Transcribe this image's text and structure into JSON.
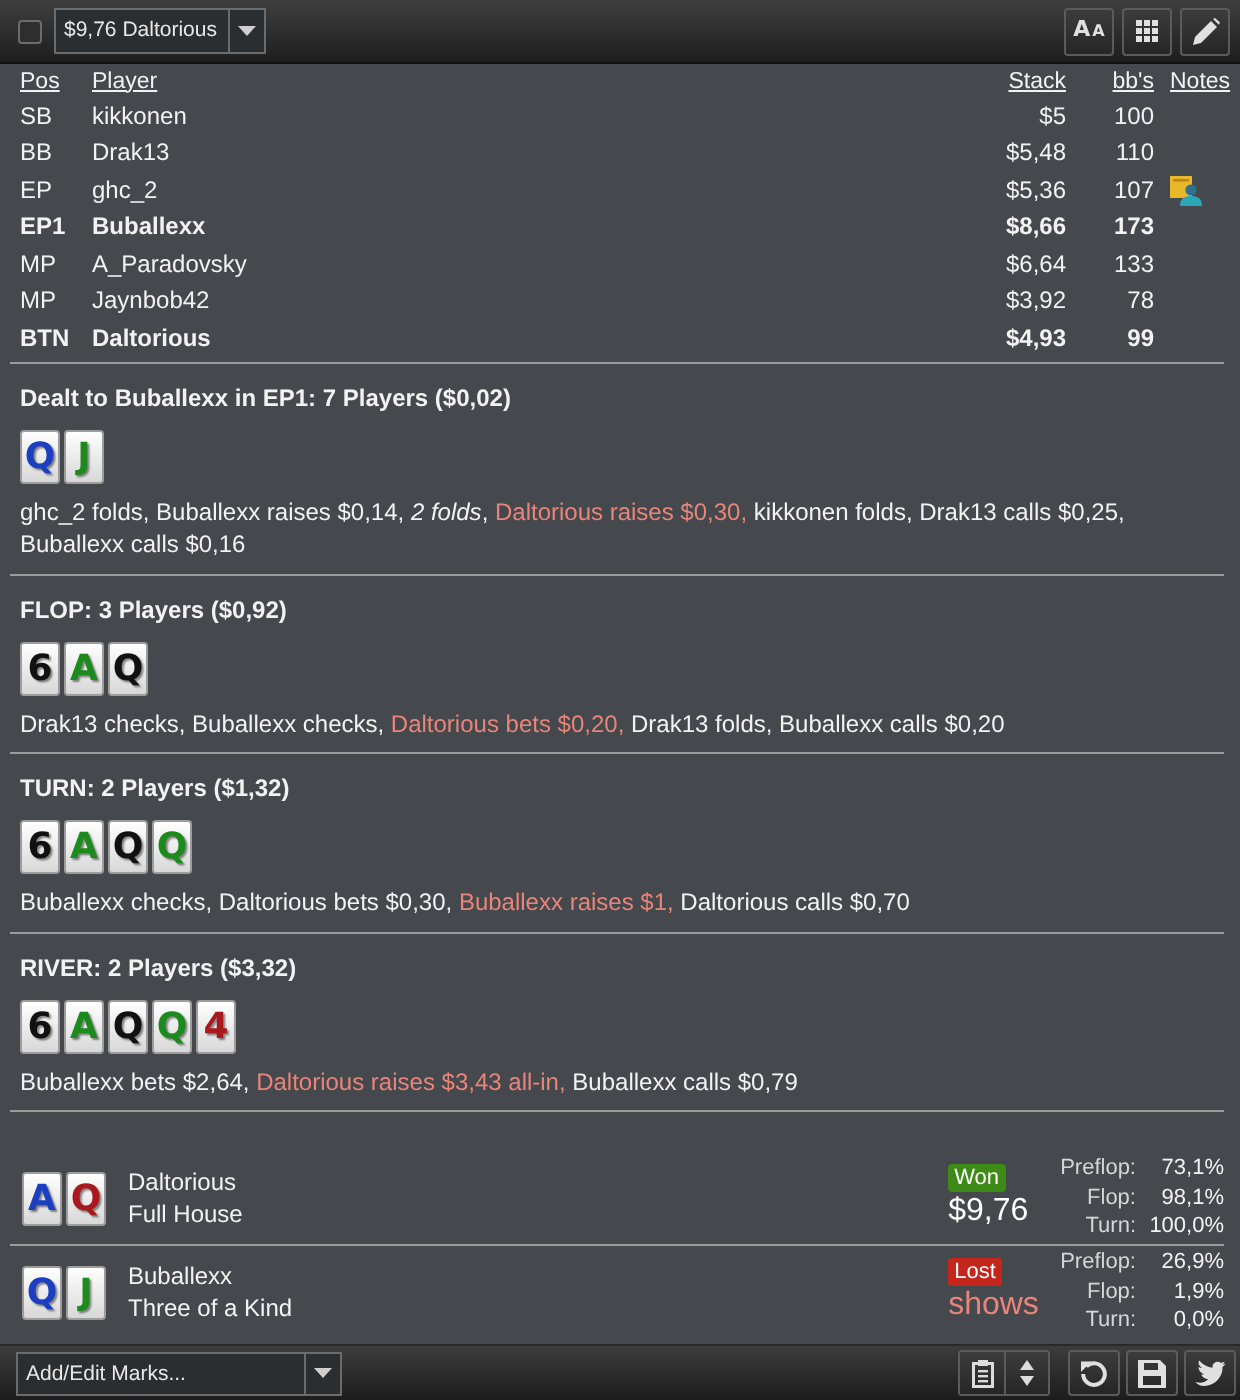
{
  "toolbar": {
    "checkbox": {
      "checked": false
    },
    "hand_dropdown": {
      "value": "$9,76 Daltorious"
    },
    "font_button": {
      "glyphs": [
        "A",
        "A"
      ]
    }
  },
  "players_table": {
    "columns": [
      "Pos",
      "Player",
      "Stack",
      "bb's",
      "Notes"
    ],
    "rows": [
      {
        "pos": "SB",
        "player": "kikkonen",
        "stack": "$5",
        "bbs": "100",
        "bold": false,
        "has_note": false
      },
      {
        "pos": "BB",
        "player": "Drak13",
        "stack": "$5,48",
        "bbs": "110",
        "bold": false,
        "has_note": false
      },
      {
        "pos": "EP",
        "player": "ghc_2",
        "stack": "$5,36",
        "bbs": "107",
        "bold": false,
        "has_note": true
      },
      {
        "pos": "EP1",
        "player": "Buballexx",
        "stack": "$8,66",
        "bbs": "173",
        "bold": true,
        "has_note": false
      },
      {
        "pos": "MP",
        "player": "A_Paradovsky",
        "stack": "$6,64",
        "bbs": "133",
        "bold": false,
        "has_note": false
      },
      {
        "pos": "MP",
        "player": "Jaynbob42",
        "stack": "$3,92",
        "bbs": "78",
        "bold": false,
        "has_note": false
      },
      {
        "pos": "BTN",
        "player": "Daltorious",
        "stack": "$4,93",
        "bbs": "99",
        "bold": true,
        "has_note": false
      }
    ]
  },
  "streets": [
    {
      "title": "Dealt to Buballexx in EP1: 7 Players ($0,02)",
      "cards": [
        {
          "rank": "Q",
          "color": "#1b3fc0"
        },
        {
          "rank": "J",
          "color": "#1d8a1d"
        }
      ],
      "actions": [
        {
          "text": "ghc_2 folds, Buballexx raises $0,14, ",
          "kind": "plain"
        },
        {
          "text": "2 folds",
          "kind": "italic"
        },
        {
          "text": ", ",
          "kind": "plain"
        },
        {
          "text": "Daltorious raises $0,30,",
          "kind": "raise"
        },
        {
          "text": " kikkonen folds, Drak13 calls $0,25, Buballexx calls $0,16",
          "kind": "plain"
        }
      ]
    },
    {
      "title": "FLOP: 3 Players ($0,92)",
      "cards": [
        {
          "rank": "6",
          "color": "#111111"
        },
        {
          "rank": "A",
          "color": "#1d8a1d"
        },
        {
          "rank": "Q",
          "color": "#111111"
        }
      ],
      "actions": [
        {
          "text": "Drak13 checks, Buballexx checks, ",
          "kind": "plain"
        },
        {
          "text": "Daltorious bets $0,20,",
          "kind": "raise"
        },
        {
          "text": " Drak13 folds, Buballexx calls $0,20",
          "kind": "plain"
        }
      ]
    },
    {
      "title": "TURN: 2 Players ($1,32)",
      "cards": [
        {
          "rank": "6",
          "color": "#111111"
        },
        {
          "rank": "A",
          "color": "#1d8a1d"
        },
        {
          "rank": "Q",
          "color": "#111111"
        },
        {
          "rank": "Q",
          "color": "#1d8a1d"
        }
      ],
      "actions": [
        {
          "text": "Buballexx checks, Daltorious bets $0,30, ",
          "kind": "plain"
        },
        {
          "text": "Buballexx raises $1,",
          "kind": "raise"
        },
        {
          "text": " Daltorious calls $0,70",
          "kind": "plain"
        }
      ]
    },
    {
      "title": "RIVER: 2 Players ($3,32)",
      "cards": [
        {
          "rank": "6",
          "color": "#111111"
        },
        {
          "rank": "A",
          "color": "#1d8a1d"
        },
        {
          "rank": "Q",
          "color": "#111111"
        },
        {
          "rank": "Q",
          "color": "#1d8a1d"
        },
        {
          "rank": "4",
          "color": "#a8181c"
        }
      ],
      "actions": [
        {
          "text": "Buballexx bets $2,64, ",
          "kind": "plain"
        },
        {
          "text": "Daltorious raises $3,43 all-in,",
          "kind": "raise"
        },
        {
          "text": " Buballexx calls $0,79",
          "kind": "plain"
        }
      ]
    }
  ],
  "showdown": [
    {
      "cards": [
        {
          "rank": "A",
          "color": "#1b3fc0"
        },
        {
          "rank": "Q",
          "color": "#a8181c"
        }
      ],
      "player": "Daltorious",
      "hand": "Full House",
      "won": true,
      "badge": "Won",
      "amount": "$9,76",
      "equity": [
        {
          "label": "Preflop:",
          "value": "73,1%"
        },
        {
          "label": "Flop:",
          "value": "98,1%"
        },
        {
          "label": "Turn:",
          "value": "100,0%"
        }
      ]
    },
    {
      "cards": [
        {
          "rank": "Q",
          "color": "#1b3fc0"
        },
        {
          "rank": "J",
          "color": "#1d8a1d"
        }
      ],
      "player": "Buballexx",
      "hand": "Three of a Kind",
      "won": false,
      "badge": "Lost",
      "amount": "shows",
      "equity": [
        {
          "label": "Preflop:",
          "value": "26,9%"
        },
        {
          "label": "Flop:",
          "value": "1,9%"
        },
        {
          "label": "Turn:",
          "value": "0,0%"
        }
      ]
    }
  ],
  "bottom_bar": {
    "marks_dropdown": {
      "value": "Add/Edit Marks..."
    }
  }
}
